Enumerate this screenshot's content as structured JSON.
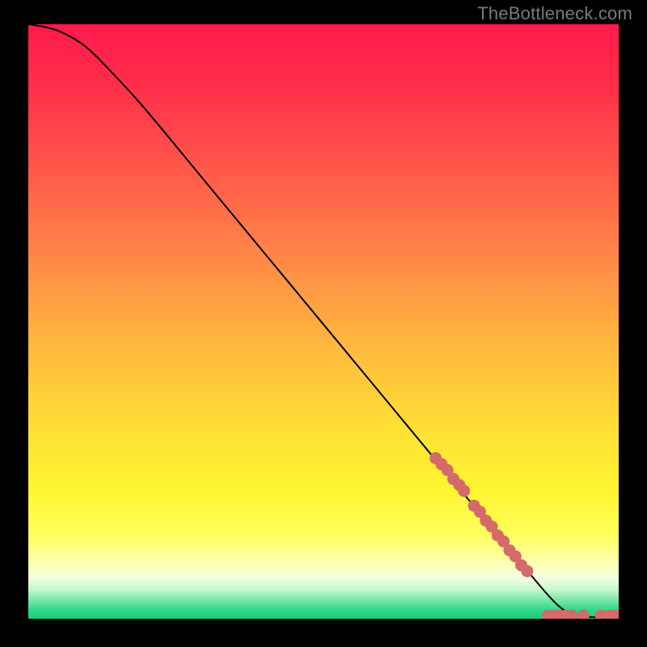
{
  "watermark": "TheBottleneck.com",
  "chart_data": {
    "type": "line",
    "title": "",
    "xlabel": "",
    "ylabel": "",
    "xlim": [
      0,
      100
    ],
    "ylim": [
      0,
      100
    ],
    "curve": [
      {
        "x": 0,
        "y": 100
      },
      {
        "x": 3,
        "y": 99.5
      },
      {
        "x": 6,
        "y": 98.5
      },
      {
        "x": 10,
        "y": 96
      },
      {
        "x": 15,
        "y": 91
      },
      {
        "x": 20,
        "y": 85.5
      },
      {
        "x": 30,
        "y": 73.5
      },
      {
        "x": 40,
        "y": 61.5
      },
      {
        "x": 50,
        "y": 49.5
      },
      {
        "x": 60,
        "y": 37.5
      },
      {
        "x": 70,
        "y": 25.5
      },
      {
        "x": 80,
        "y": 13.5
      },
      {
        "x": 85,
        "y": 7.5
      },
      {
        "x": 88,
        "y": 4
      },
      {
        "x": 90,
        "y": 2
      },
      {
        "x": 92,
        "y": 0.8
      },
      {
        "x": 95,
        "y": 0.3
      },
      {
        "x": 100,
        "y": 0.2
      }
    ],
    "scatter": [
      {
        "x": 69,
        "y": 27
      },
      {
        "x": 70,
        "y": 26
      },
      {
        "x": 71,
        "y": 25
      },
      {
        "x": 72,
        "y": 23.5
      },
      {
        "x": 73,
        "y": 22.5
      },
      {
        "x": 73.8,
        "y": 21.5
      },
      {
        "x": 75.5,
        "y": 19
      },
      {
        "x": 76.5,
        "y": 18
      },
      {
        "x": 77.5,
        "y": 16.5
      },
      {
        "x": 78.5,
        "y": 15.5
      },
      {
        "x": 79.5,
        "y": 14
      },
      {
        "x": 80.5,
        "y": 13
      },
      {
        "x": 81.5,
        "y": 11.5
      },
      {
        "x": 82.5,
        "y": 10.5
      },
      {
        "x": 83.5,
        "y": 9
      },
      {
        "x": 84.5,
        "y": 8
      },
      {
        "x": 88,
        "y": 0.5
      },
      {
        "x": 89,
        "y": 0.5
      },
      {
        "x": 90,
        "y": 0.5
      },
      {
        "x": 91,
        "y": 0.5
      },
      {
        "x": 92,
        "y": 0.5
      },
      {
        "x": 94,
        "y": 0.5
      },
      {
        "x": 97,
        "y": 0.5
      },
      {
        "x": 98.5,
        "y": 0.5
      },
      {
        "x": 99.5,
        "y": 0.5
      }
    ],
    "gradient_stops": [
      {
        "offset": 0.0,
        "color": "#ff1a4b"
      },
      {
        "offset": 0.1,
        "color": "#ff2d4b"
      },
      {
        "offset": 0.25,
        "color": "#ff5a4a"
      },
      {
        "offset": 0.4,
        "color": "#ff8a47"
      },
      {
        "offset": 0.55,
        "color": "#ffbb3d"
      },
      {
        "offset": 0.68,
        "color": "#ffe036"
      },
      {
        "offset": 0.78,
        "color": "#fff430"
      },
      {
        "offset": 0.86,
        "color": "#ffff5e"
      },
      {
        "offset": 0.905,
        "color": "#ffffb0"
      },
      {
        "offset": 0.93,
        "color": "#f4ffe0"
      },
      {
        "offset": 0.95,
        "color": "#c9f7d0"
      },
      {
        "offset": 0.968,
        "color": "#7ce8a8"
      },
      {
        "offset": 0.985,
        "color": "#31d88b"
      },
      {
        "offset": 1.0,
        "color": "#18cc7e"
      }
    ],
    "point_color": "#d46a6a",
    "curve_color": "#000000"
  }
}
